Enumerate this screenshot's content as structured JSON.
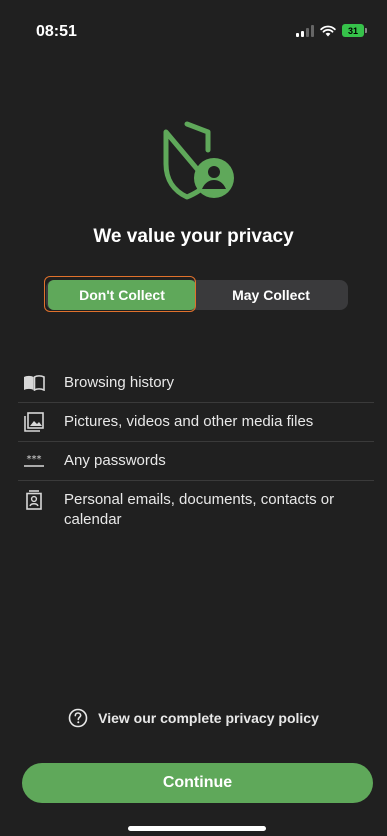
{
  "status_bar": {
    "time": "08:51",
    "battery": "31"
  },
  "header": {
    "icon": "shield-person-icon",
    "title": "We value your privacy"
  },
  "segmented": {
    "selected": "dont_collect",
    "dont_collect_label": "Don't Collect",
    "may_collect_label": "May Collect"
  },
  "items": [
    {
      "icon": "book-icon",
      "label": "Browsing history"
    },
    {
      "icon": "image-icon",
      "label": "Pictures, videos and other media files"
    },
    {
      "icon": "password-icon",
      "label": "Any passwords"
    },
    {
      "icon": "contact-card-icon",
      "label": "Personal emails, documents, contacts or calendar"
    }
  ],
  "policy_link": {
    "icon": "question-circle-icon",
    "label": "View our complete privacy policy"
  },
  "continue_label": "Continue",
  "colors": {
    "accent": "#5fa85a",
    "background": "#202020",
    "focus": "#e0712c"
  }
}
